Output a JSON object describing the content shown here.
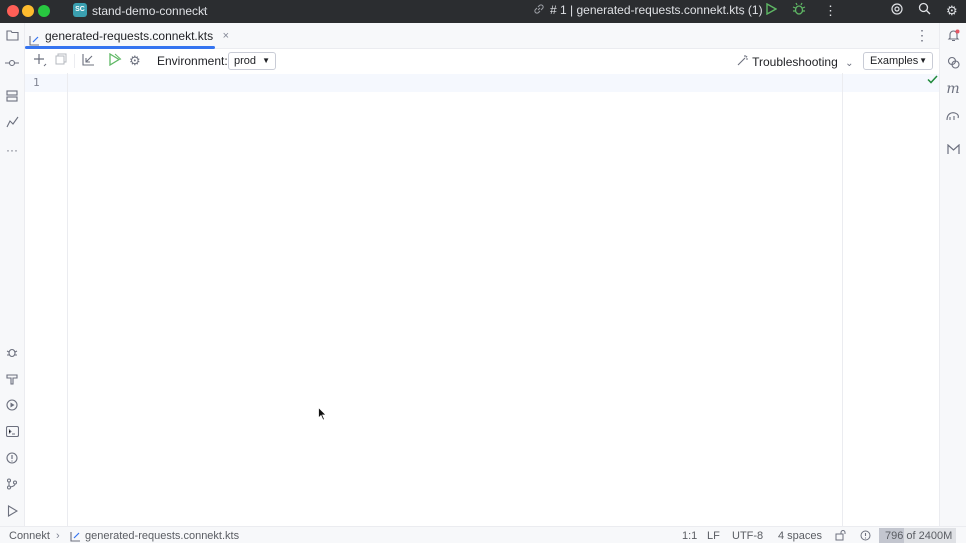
{
  "titlebar": {
    "project_badge": "SC",
    "project_name": "stand-demo-conneckt",
    "run_config": "# 1 | generated-requests.connekt.kts (1)"
  },
  "tab": {
    "label": "generated-requests.connekt.kts",
    "close": "×"
  },
  "toolbar": {
    "environment_label": "Environment:",
    "environment_value": "prod",
    "troubleshooting_label": "Troubleshooting",
    "examples_label": "Examples"
  },
  "editor": {
    "line_numbers": [
      "1"
    ]
  },
  "statusbar": {
    "breadcrumb_root": "Connekt",
    "breadcrumb_file": "generated-requests.connekt.kts",
    "position": "1:1",
    "line_ending": "LF",
    "encoding": "UTF-8",
    "indent": "4 spaces",
    "memory": "796 of 2400M",
    "memory_used_fraction": 0.33
  },
  "colors": {
    "accent": "#3574f0",
    "titlebar_bg": "#2b2d30",
    "success": "#208a3c"
  }
}
